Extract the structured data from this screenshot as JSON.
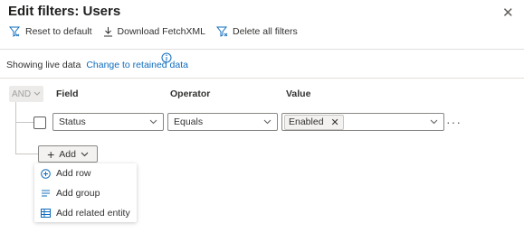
{
  "title": "Edit filters: Users",
  "close_icon": "close-icon",
  "toolbar": {
    "reset_label": "Reset to default",
    "download_label": "Download FetchXML",
    "delete_label": "Delete all filters"
  },
  "data_status": {
    "label": "Showing live data",
    "link": "Change to retained data"
  },
  "group": {
    "operator": "AND"
  },
  "columns": {
    "field": "Field",
    "operator": "Operator",
    "value": "Value"
  },
  "condition": {
    "field": "Status",
    "operator": "Equals",
    "value_chip": "Enabled"
  },
  "add_button": {
    "label": "Add"
  },
  "add_menu": {
    "items": [
      {
        "label": "Add row",
        "icon": "add-circle-icon"
      },
      {
        "label": "Add group",
        "icon": "lines-icon"
      },
      {
        "label": "Add related entity",
        "icon": "table-icon"
      }
    ]
  },
  "colors": {
    "accent": "#0f6cbd",
    "text": "#323130",
    "border": "#8a8886"
  }
}
